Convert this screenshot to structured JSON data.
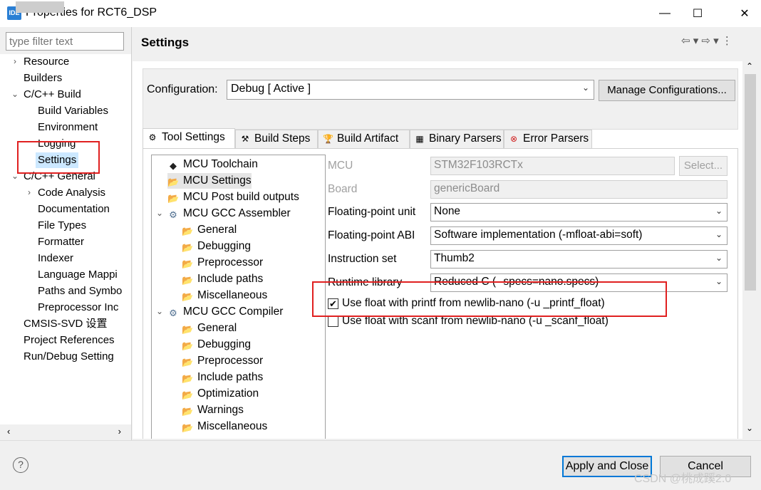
{
  "window": {
    "icon_text": "IDE",
    "title": "Properties for RCT6_DSP",
    "minimize": "—",
    "maximize": "☐",
    "close": "✕"
  },
  "filter": {
    "placeholder": "type filter text"
  },
  "left_tree": [
    {
      "label": "Resource",
      "chev": "›"
    },
    {
      "label": "Builders"
    },
    {
      "label": "C/C++ Build",
      "chev": "⌄"
    },
    {
      "label": "Build Variables"
    },
    {
      "label": "Environment"
    },
    {
      "label": "Logging"
    },
    {
      "label": "Settings"
    },
    {
      "label": "C/C++ General",
      "chev": "⌄"
    },
    {
      "label": "Code Analysis",
      "chev": "›"
    },
    {
      "label": "Documentation"
    },
    {
      "label": "File Types"
    },
    {
      "label": "Formatter"
    },
    {
      "label": "Indexer"
    },
    {
      "label": "Language Mappi"
    },
    {
      "label": "Paths and Symbo"
    },
    {
      "label": "Preprocessor Inc"
    },
    {
      "label": "CMSIS-SVD 设置"
    },
    {
      "label": "Project References"
    },
    {
      "label": "Run/Debug Setting"
    }
  ],
  "header": {
    "title": "Settings",
    "nav": "⇦ ▾ ⇨ ▾ ⋮"
  },
  "config": {
    "label": "Configuration:",
    "value": "Debug  [ Active ]",
    "manage_label": "Manage Configurations..."
  },
  "tabs": [
    {
      "label": "Tool Settings",
      "icon": "⚙"
    },
    {
      "label": "Build Steps",
      "icon": "⚒"
    },
    {
      "label": "Build Artifact",
      "icon": "🏆"
    },
    {
      "label": "Binary Parsers",
      "icon": "▦"
    },
    {
      "label": "Error Parsers",
      "icon": "⊗"
    }
  ],
  "inner_tree": [
    {
      "label": "MCU Toolchain",
      "icon": "◆"
    },
    {
      "label": "MCU Settings",
      "icon": "📂"
    },
    {
      "label": "MCU Post build outputs",
      "icon": "📂"
    },
    {
      "label": "MCU GCC Assembler",
      "icon": "⚙",
      "chev": "⌄"
    },
    {
      "label": "General",
      "icon": "📂"
    },
    {
      "label": "Debugging",
      "icon": "📂"
    },
    {
      "label": "Preprocessor",
      "icon": "📂"
    },
    {
      "label": "Include paths",
      "icon": "📂"
    },
    {
      "label": "Miscellaneous",
      "icon": "📂"
    },
    {
      "label": "MCU GCC Compiler",
      "icon": "⚙",
      "chev": "⌄"
    },
    {
      "label": "General",
      "icon": "📂"
    },
    {
      "label": "Debugging",
      "icon": "📂"
    },
    {
      "label": "Preprocessor",
      "icon": "📂"
    },
    {
      "label": "Include paths",
      "icon": "📂"
    },
    {
      "label": "Optimization",
      "icon": "📂"
    },
    {
      "label": "Warnings",
      "icon": "📂"
    },
    {
      "label": "Miscellaneous",
      "icon": "📂"
    }
  ],
  "form": {
    "mcu_label": "MCU",
    "mcu_value": "STM32F103RCTx",
    "select_label": "Select...",
    "board_label": "Board",
    "board_value": "genericBoard",
    "fpu_label": "Floating-point unit",
    "fpu_value": "None",
    "fpabi_label": "Floating-point ABI",
    "fpabi_value": "Software implementation (-mfloat-abi=soft)",
    "iset_label": "Instruction set",
    "iset_value": "Thumb2",
    "rtlib_label": "Runtime library",
    "rtlib_value": "Reduced C (--specs=nano.specs)",
    "printf_float_label": "Use float with printf from newlib-nano (-u _printf_float)",
    "printf_float_checked": "✔",
    "scanf_float_label": "Use float with scanf from newlib-nano (-u _scanf_float)"
  },
  "footer": {
    "help": "?",
    "apply_label": "Apply and Close",
    "cancel_label": "Cancel",
    "watermark": "CSDN @桃成蹊2.0"
  },
  "colors": {
    "annotation": "#e02020",
    "primary_border": "#0078d7"
  }
}
